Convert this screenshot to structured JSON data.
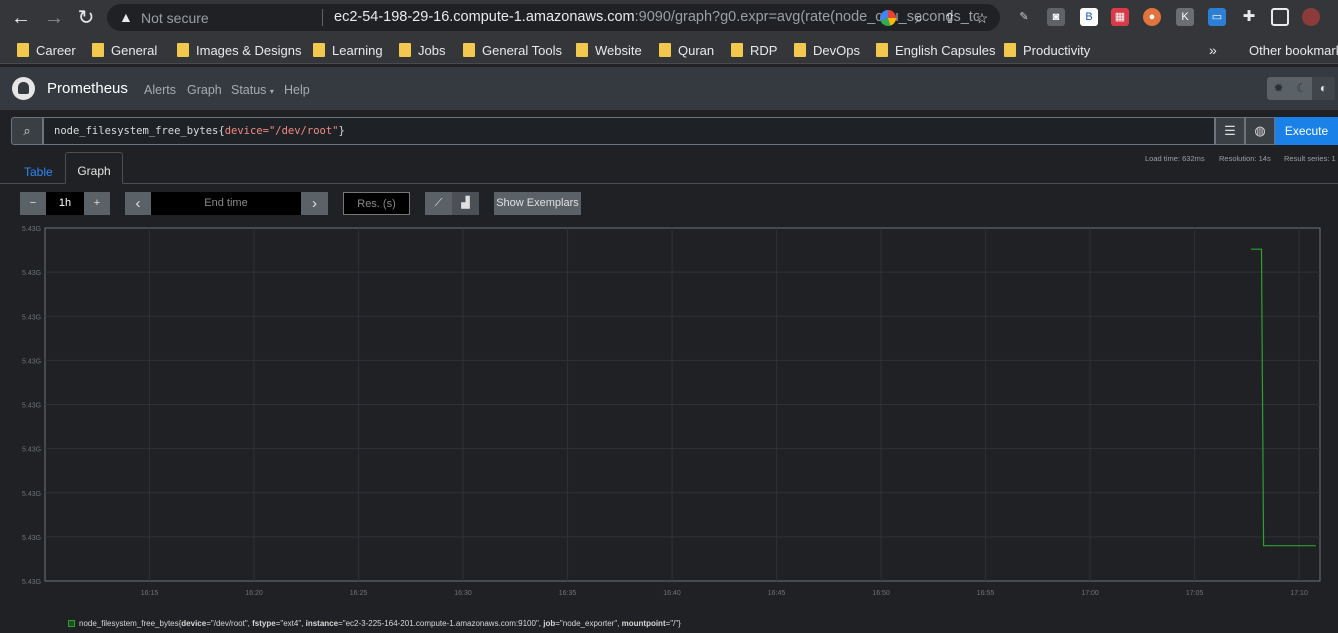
{
  "browser": {
    "security_label": "Not secure",
    "url_host": "ec2-54-198-29-16.compute-1.amazonaws.com",
    "url_rest": ":9090/graph?g0.expr=avg(rate(node_cpu_seconds_total..."
  },
  "bookmarks": [
    "Career",
    "General",
    "Images & Designs",
    "Learning",
    "Jobs",
    "General Tools",
    "Website",
    "Quran",
    "RDP",
    "DevOps",
    "English Capsules",
    "Productivity"
  ],
  "bookmarks_more": "»",
  "other_bookmarks": "Other bookmarks",
  "nav": {
    "brand": "Prometheus",
    "links": [
      "Alerts",
      "Graph",
      "Status",
      "Help"
    ]
  },
  "query": {
    "metric": "node_filesystem_free_bytes{",
    "label": "device=",
    "value": "\"/dev/root\"",
    "close": "}",
    "execute": "Execute"
  },
  "stats": {
    "load_time": "Load time: 632ms",
    "resolution": "Resolution: 14s",
    "result_series": "Result series: 1"
  },
  "tabs": {
    "table": "Table",
    "graph": "Graph"
  },
  "controls": {
    "minus": "−",
    "range": "1h",
    "plus": "+",
    "prev": "‹",
    "end_time_placeholder": "End time",
    "next": "›",
    "res_placeholder": "Res. (s)",
    "show_exemplars": "Show Exemplars"
  },
  "chart_data": {
    "type": "line",
    "y_ticks": [
      "5.43G",
      "5.43G",
      "5.43G",
      "5.43G",
      "5.43G",
      "5.43G",
      "5.43G",
      "5.43G",
      "5.43G"
    ],
    "x_ticks": [
      "16:15",
      "16:20",
      "16:25",
      "16:30",
      "16:35",
      "16:40",
      "16:45",
      "16:50",
      "16:55",
      "17:00",
      "17:05",
      "17:10"
    ],
    "x_range_minutes": [
      "16:10",
      "17:11"
    ],
    "grid": true,
    "series": [
      {
        "color": "#2ea02e",
        "points_minutes_since_1610": [
          [
            57.7,
            0.94
          ],
          [
            58.2,
            0.94
          ],
          [
            58.3,
            0.1
          ],
          [
            60.8,
            0.1
          ]
        ]
      }
    ]
  },
  "legend": {
    "metric": "node_filesystem_free_bytes{",
    "k1": "device",
    "v1": "=\"/dev/root\", ",
    "k2": "fstype",
    "v2": "=\"ext4\", ",
    "k3": "instance",
    "v3": "=\"ec2-3-225-164-201.compute-1.amazonaws.com:9100\", ",
    "k4": "job",
    "v4": "=\"node_exporter\", ",
    "k5": "mountpoint",
    "v5": "=\"/\"}"
  }
}
